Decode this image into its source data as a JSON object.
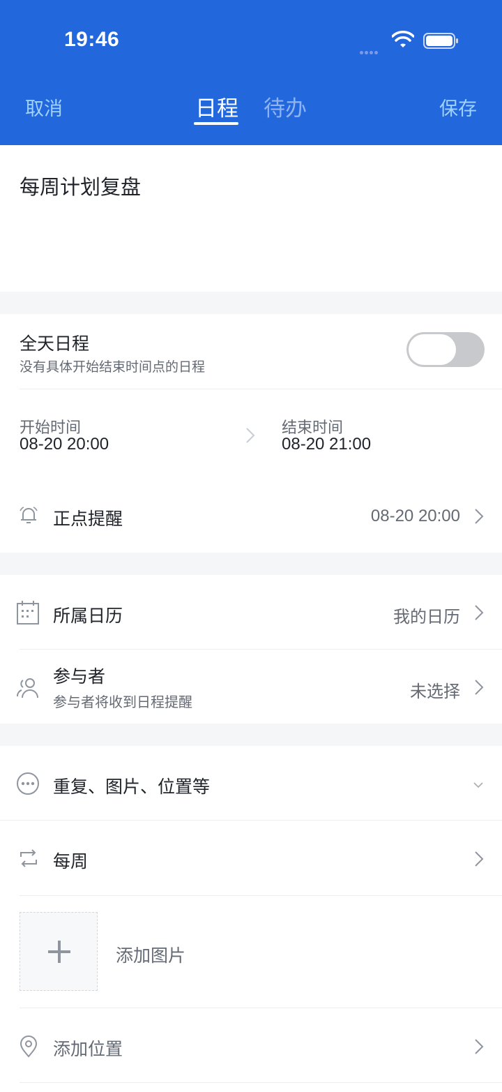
{
  "status": {
    "time": "19:46"
  },
  "nav": {
    "cancel": "取消",
    "save": "保存",
    "tabs": [
      "日程",
      "待办"
    ]
  },
  "event": {
    "title": "每周计划复盘"
  },
  "all_day": {
    "label": "全天日程",
    "desc": "没有具体开始结束时间点的日程",
    "enabled": false
  },
  "time": {
    "start_label": "开始时间",
    "start_value": "08-20 20:00",
    "end_label": "结束时间",
    "end_value": "08-20 21:00"
  },
  "reminder": {
    "label": "正点提醒",
    "value": "08-20 20:00"
  },
  "calendar": {
    "label": "所属日历",
    "value": "我的日历"
  },
  "participants": {
    "label": "参与者",
    "desc": "参与者将收到日程提醒",
    "value": "未选择"
  },
  "more": {
    "label": "重复、图片、位置等"
  },
  "repeat": {
    "label": "每周"
  },
  "image": {
    "label": "添加图片"
  },
  "location": {
    "label": "添加位置"
  },
  "colors": {
    "header": "#2267db",
    "nav_action": "#9fd2ff",
    "inactive_tab": "#8fb3ee"
  },
  "icons": [
    "wifi-icon",
    "battery-icon",
    "bell-icon",
    "calendar-icon",
    "people-icon",
    "more-icon",
    "repeat-icon",
    "plus-icon",
    "location-pin-icon",
    "chevron-right-icon",
    "chevron-down-icon"
  ]
}
